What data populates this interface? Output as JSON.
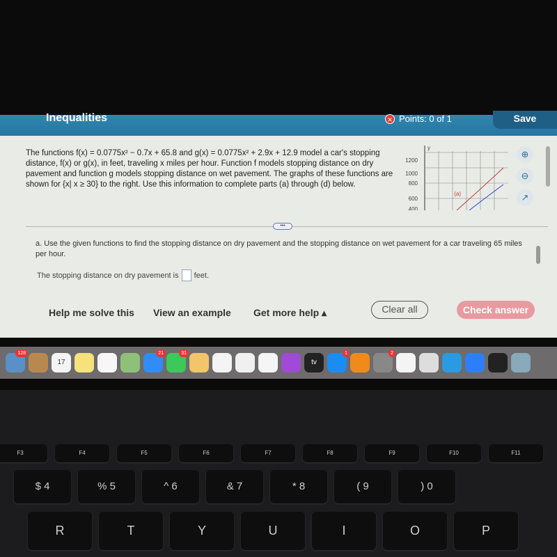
{
  "header": {
    "title": "Inequalities",
    "points": "Points: 0 of 1",
    "save_label": "Save",
    "status_icon": "x-circle-icon"
  },
  "problem": {
    "text": "The functions f(x) = 0.0775x² − 0.7x + 65.8 and g(x) = 0.0775x² + 2.9x + 12.9 model a car's stopping distance, f(x) or g(x), in feet, traveling x miles per hour. Function f models stopping distance on dry pavement and function g models stopping distance on wet pavement. The graphs of these functions are shown for {x| x ≥ 30} to the right. Use this information to complete parts (a) through (d) below."
  },
  "graph": {
    "y_axis_label": "y",
    "y_ticks": [
      "1200",
      "1000",
      "800",
      "600",
      "400"
    ],
    "curve_label": "(a)",
    "colors": {
      "f": "#c0393b",
      "g": "#2b3fd6"
    }
  },
  "tools": [
    "zoom-in-icon",
    "zoom-out-icon",
    "popout-icon"
  ],
  "expand_label": "•••",
  "question": {
    "text": "a. Use the given functions to find the stopping distance on dry pavement and the stopping distance on wet pavement for a car traveling 65 miles per hour.",
    "answer_prefix": "The stopping distance on dry pavement is",
    "answer_value": "",
    "answer_suffix": "feet."
  },
  "footer": {
    "help": "Help me solve this",
    "example": "View an example",
    "more_help": "Get more help ▴",
    "clear": "Clear all",
    "check": "Check answer"
  },
  "dock": [
    {
      "name": "preview",
      "color": "#5a8fc8",
      "badge": "128"
    },
    {
      "name": "contacts",
      "color": "#b8894f"
    },
    {
      "name": "calendar",
      "color": "#f4f4f4",
      "text": "17"
    },
    {
      "name": "notes",
      "color": "#f5e27a"
    },
    {
      "name": "reminders",
      "color": "#f7f7f7"
    },
    {
      "name": "maps",
      "color": "#8fc07a"
    },
    {
      "name": "messages",
      "color": "#2f8df5",
      "badge": "21"
    },
    {
      "name": "facetime",
      "color": "#3cc85a",
      "badge": "31"
    },
    {
      "name": "pages",
      "color": "#f2c56a"
    },
    {
      "name": "numbers",
      "color": "#f4f4f4"
    },
    {
      "name": "photos",
      "color": "#f0f0f0"
    },
    {
      "name": "music",
      "color": "#f5f5f5"
    },
    {
      "name": "podcasts",
      "color": "#a04ad8"
    },
    {
      "name": "tv",
      "color": "#222",
      "text": "tv"
    },
    {
      "name": "app-store",
      "color": "#1b8cf2",
      "badge": "1"
    },
    {
      "name": "books",
      "color": "#f08a1c"
    },
    {
      "name": "system-preferences",
      "color": "#888",
      "badge": "2"
    },
    {
      "name": "news",
      "color": "#f4f4f4"
    },
    {
      "name": "app",
      "color": "#ddd"
    },
    {
      "name": "app",
      "color": "#2a9be0"
    },
    {
      "name": "zoom",
      "color": "#2d7ff9"
    },
    {
      "name": "app",
      "color": "#222"
    },
    {
      "name": "preview-photos",
      "color": "#8ab"
    }
  ],
  "keyboard": {
    "fkeys": [
      "F3",
      "F4",
      "F5",
      "F6",
      "F7",
      "F8",
      "F9",
      "F10",
      "F11"
    ],
    "numbers": [
      [
        "$",
        "4"
      ],
      [
        "%",
        "5"
      ],
      [
        "^",
        "6"
      ],
      [
        "&",
        "7"
      ],
      [
        "*",
        "8"
      ],
      [
        "(",
        "9"
      ],
      [
        ")",
        "0"
      ]
    ],
    "letters": [
      "R",
      "T",
      "Y",
      "U",
      "I",
      "O",
      "P"
    ]
  }
}
